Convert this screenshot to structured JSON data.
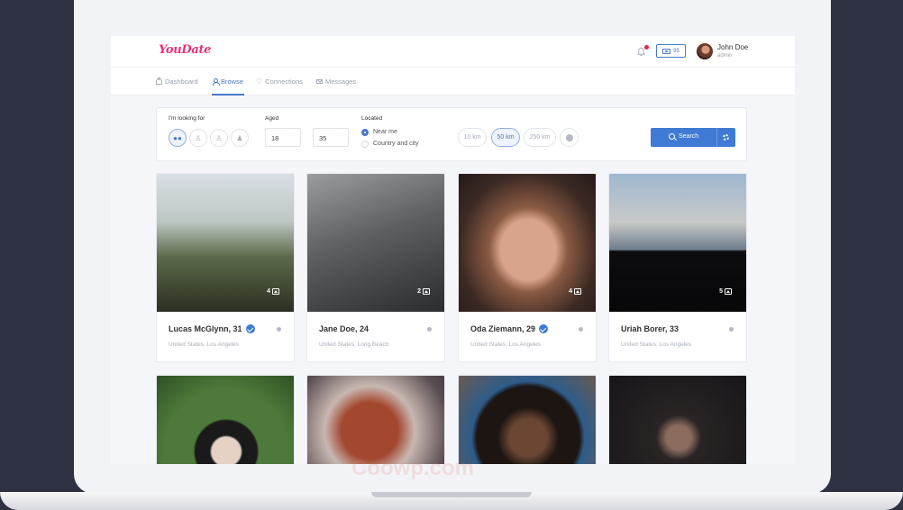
{
  "app": {
    "logo": "YouDate"
  },
  "header": {
    "credits": "95",
    "user_name": "John Doe",
    "user_role": "admin"
  },
  "nav": {
    "items": [
      {
        "label": "Dashboard",
        "icon": "home-icon"
      },
      {
        "label": "Browse",
        "icon": "user-icon",
        "active": true
      },
      {
        "label": "Connections",
        "icon": "heart-icon"
      },
      {
        "label": "Messages",
        "icon": "mail-icon"
      }
    ]
  },
  "filter": {
    "looking_for_label": "I'm looking for",
    "aged_label": "Aged",
    "age_min": "18",
    "age_max": "35",
    "located_label": "Located",
    "near_me": "Near me",
    "country_city": "Country and city",
    "distances": [
      "10 km",
      "50 km",
      "250 km"
    ],
    "selected_distance": "50 km",
    "search_label": "Search"
  },
  "profiles": [
    {
      "name": "Lucas McGlynn, 31",
      "location": "United States, Los Angeles",
      "photos": "4",
      "verified": true
    },
    {
      "name": "Jane Doe, 24",
      "location": "United States, Long Beach",
      "photos": "2",
      "verified": false
    },
    {
      "name": "Oda Ziemann, 29",
      "location": "United States, Los Angeles",
      "photos": "4",
      "verified": true
    },
    {
      "name": "Uriah Borer, 33",
      "location": "United States, Los Angeles",
      "photos": "5",
      "verified": false
    }
  ],
  "watermark": "Coowp.com",
  "colors": {
    "accent": "#3f7ad4",
    "logo": "#e5347a"
  }
}
